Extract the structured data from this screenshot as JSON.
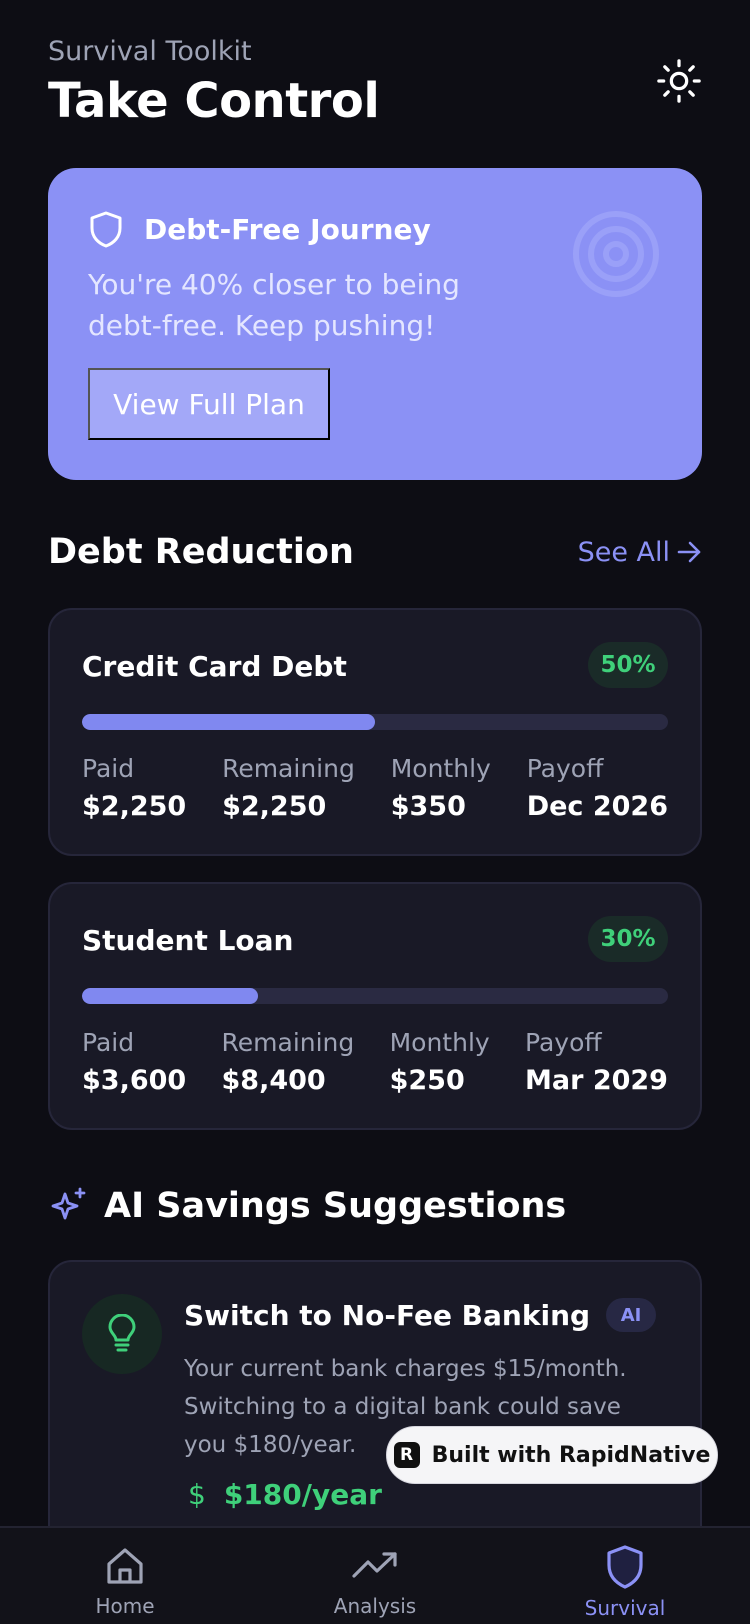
{
  "header": {
    "eyebrow": "Survival Toolkit",
    "title": "Take Control",
    "theme_icon": "sun-icon"
  },
  "hero": {
    "icon": "shield-icon",
    "title": "Debt-Free Journey",
    "text": "You're 40% closer to being debt-free. Keep pushing!",
    "button": "View Full Plan",
    "decor_icon": "target-icon",
    "color": "#8b91f5"
  },
  "debt_section": {
    "title": "Debt Reduction",
    "see_all": "See All",
    "debts": [
      {
        "name": "Credit Card Debt",
        "percent_label": "50%",
        "progress": 0.5,
        "paid_label": "Paid",
        "paid": "$2,250",
        "remaining_label": "Remaining",
        "remaining": "$2,250",
        "monthly_label": "Monthly",
        "monthly": "$350",
        "payoff_label": "Payoff",
        "payoff": "Dec 2026"
      },
      {
        "name": "Student Loan",
        "percent_label": "30%",
        "progress": 0.3,
        "paid_label": "Paid",
        "paid": "$3,600",
        "remaining_label": "Remaining",
        "remaining": "$8,400",
        "monthly_label": "Monthly",
        "monthly": "$250",
        "payoff_label": "Payoff",
        "payoff": "Mar 2029"
      }
    ]
  },
  "ai_section": {
    "title": "AI Savings Suggestions",
    "icon": "sparkle-icon",
    "suggestion": {
      "icon": "lightbulb-icon",
      "title": "Switch to No-Fee Banking",
      "badge": "AI",
      "text": "Your current bank charges $15/month. Switching to a digital bank could save you $180/year.",
      "currency_symbol": "$",
      "amount": "$180/year"
    }
  },
  "built_with": {
    "logo_letter": "R",
    "text": "Built with RapidNative"
  },
  "tabs": [
    {
      "label": "Home",
      "icon": "home-icon"
    },
    {
      "label": "Analysis",
      "icon": "trending-up-icon"
    },
    {
      "label": "Survival",
      "icon": "shield-icon",
      "active": true
    }
  ],
  "colors": {
    "accent": "#8b91f5",
    "success": "#3fd07a",
    "background": "#0d0d14",
    "card": "#191926"
  }
}
